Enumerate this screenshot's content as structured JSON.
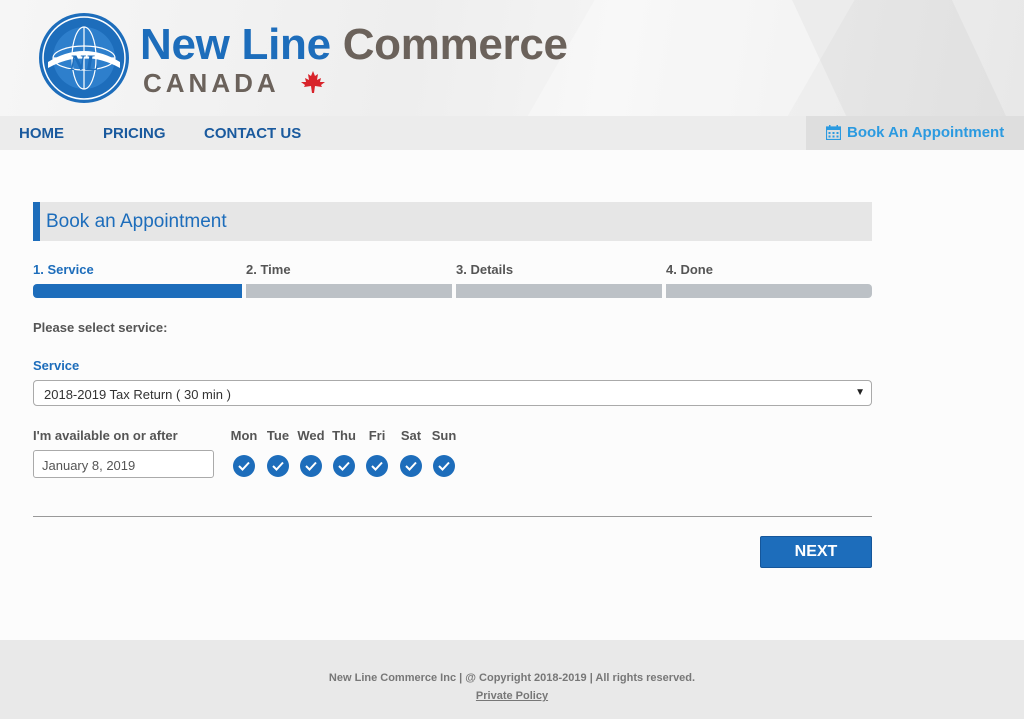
{
  "brand": {
    "name_part1": "New Line",
    "name_part2": "Commerce",
    "subtitle": "CANADA",
    "logo_icon": "globe-nl-logo",
    "leaf_icon": "maple-leaf-icon"
  },
  "nav": {
    "items": [
      {
        "label": "HOME"
      },
      {
        "label": "PRICING"
      },
      {
        "label": "CONTACT US"
      }
    ],
    "book_label": "Book An Appointment",
    "book_icon": "calendar-icon"
  },
  "booking": {
    "title": "Book an Appointment",
    "steps": [
      {
        "label": "1. Service",
        "active": true
      },
      {
        "label": "2. Time",
        "active": false
      },
      {
        "label": "3. Details",
        "active": false
      },
      {
        "label": "4. Done",
        "active": false
      }
    ],
    "prompt": "Please select service:",
    "service_label": "Service",
    "service_value": "2018-2019 Tax Return ( 30 min )",
    "available_label": "I'm available on or after",
    "date_value": "January 8, 2019",
    "days": [
      {
        "label": "Mon",
        "checked": true
      },
      {
        "label": "Tue",
        "checked": true
      },
      {
        "label": "Wed",
        "checked": true
      },
      {
        "label": "Thu",
        "checked": true
      },
      {
        "label": "Fri",
        "checked": true
      },
      {
        "label": "Sat",
        "checked": true
      },
      {
        "label": "Sun",
        "checked": true
      }
    ],
    "next_label": "NEXT"
  },
  "footer": {
    "copyright": "New Line Commerce Inc | @ Copyright 2018-2019 | All rights reserved.",
    "policy_link": "Private Policy"
  },
  "colors": {
    "brand_blue": "#1d6dbb",
    "brand_gray": "#6b625b",
    "accent_light_blue": "#2b9ae0",
    "maple_red": "#d8232a"
  }
}
